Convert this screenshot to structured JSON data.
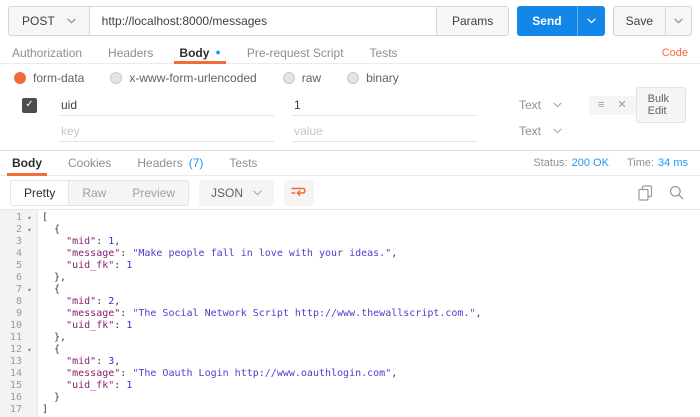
{
  "colors": {
    "accent_orange": "#f26b3a",
    "link_blue": "#2196f3",
    "send_blue": "#1287e8",
    "json_key": "#85216d",
    "json_string": "#4b41cc",
    "json_number": "#2438c8"
  },
  "icons": {
    "check": "✓",
    "reorder": "≡",
    "close": "✕",
    "fold_caret": "▾",
    "unsaved_dot": "●"
  },
  "request": {
    "method": "POST",
    "url": "http://localhost:8000/messages",
    "params_label": "Params",
    "send_label": "Send",
    "save_label": "Save",
    "code_link": "Code",
    "tabs": [
      {
        "label": "Authorization",
        "active": false
      },
      {
        "label": "Headers",
        "active": false
      },
      {
        "label": "Body",
        "active": true,
        "dot": true
      },
      {
        "label": "Pre-request Script",
        "active": false
      },
      {
        "label": "Tests",
        "active": false
      }
    ],
    "body_modes": [
      {
        "label": "form-data",
        "selected": true
      },
      {
        "label": "x-www-form-urlencoded",
        "selected": false
      },
      {
        "label": "raw",
        "selected": false
      },
      {
        "label": "binary",
        "selected": false
      }
    ],
    "form_rows": [
      {
        "key": "uid",
        "value": "1",
        "type": "Text",
        "checked": true
      }
    ],
    "new_row": {
      "key_placeholder": "key",
      "value_placeholder": "value",
      "type": "Text"
    },
    "bulk_edit_label": "Bulk Edit"
  },
  "response": {
    "tabs": [
      {
        "label": "Body",
        "active": true
      },
      {
        "label": "Cookies",
        "active": false
      },
      {
        "label": "Headers",
        "active": false,
        "count": "(7)"
      },
      {
        "label": "Tests",
        "active": false
      }
    ],
    "status_label": "Status:",
    "status_value": "200 OK",
    "time_label": "Time:",
    "time_value": "34 ms",
    "view_modes": [
      {
        "label": "Pretty",
        "active": true
      },
      {
        "label": "Raw",
        "active": false
      },
      {
        "label": "Preview",
        "active": false
      }
    ],
    "format_selector": "JSON",
    "body_json": [
      {
        "mid": 1,
        "message": "Make people fall in love with your ideas.",
        "uid_fk": 1
      },
      {
        "mid": 2,
        "message": "The Social Network Script http://www.thewallscript.com.",
        "uid_fk": 1
      },
      {
        "mid": 3,
        "message": "The Oauth Login http://www.oauthlogin.com",
        "uid_fk": 1
      }
    ],
    "code_lines": [
      {
        "n": 1,
        "fold": true,
        "seg": [
          [
            "p",
            "["
          ]
        ]
      },
      {
        "n": 2,
        "fold": true,
        "seg": [
          [
            "p",
            "  {"
          ]
        ]
      },
      {
        "n": 3,
        "seg": [
          [
            "p",
            "    "
          ],
          [
            "k",
            "\"mid\""
          ],
          [
            "p",
            ": "
          ],
          [
            "n",
            "1"
          ],
          [
            "p",
            ","
          ]
        ]
      },
      {
        "n": 4,
        "seg": [
          [
            "p",
            "    "
          ],
          [
            "k",
            "\"message\""
          ],
          [
            "p",
            ": "
          ],
          [
            "s",
            "\"Make people fall in love with your ideas.\""
          ],
          [
            "p",
            ","
          ]
        ]
      },
      {
        "n": 5,
        "seg": [
          [
            "p",
            "    "
          ],
          [
            "k",
            "\"uid_fk\""
          ],
          [
            "p",
            ": "
          ],
          [
            "n",
            "1"
          ]
        ]
      },
      {
        "n": 6,
        "seg": [
          [
            "p",
            "  },"
          ]
        ]
      },
      {
        "n": 7,
        "fold": true,
        "seg": [
          [
            "p",
            "  {"
          ]
        ]
      },
      {
        "n": 8,
        "seg": [
          [
            "p",
            "    "
          ],
          [
            "k",
            "\"mid\""
          ],
          [
            "p",
            ": "
          ],
          [
            "n",
            "2"
          ],
          [
            "p",
            ","
          ]
        ]
      },
      {
        "n": 9,
        "seg": [
          [
            "p",
            "    "
          ],
          [
            "k",
            "\"message\""
          ],
          [
            "p",
            ": "
          ],
          [
            "s",
            "\"The Social Network Script http://www.thewallscript.com.\""
          ],
          [
            "p",
            ","
          ]
        ]
      },
      {
        "n": 10,
        "seg": [
          [
            "p",
            "    "
          ],
          [
            "k",
            "\"uid_fk\""
          ],
          [
            "p",
            ": "
          ],
          [
            "n",
            "1"
          ]
        ]
      },
      {
        "n": 11,
        "seg": [
          [
            "p",
            "  },"
          ]
        ]
      },
      {
        "n": 12,
        "fold": true,
        "seg": [
          [
            "p",
            "  {"
          ]
        ]
      },
      {
        "n": 13,
        "seg": [
          [
            "p",
            "    "
          ],
          [
            "k",
            "\"mid\""
          ],
          [
            "p",
            ": "
          ],
          [
            "n",
            "3"
          ],
          [
            "p",
            ","
          ]
        ]
      },
      {
        "n": 14,
        "seg": [
          [
            "p",
            "    "
          ],
          [
            "k",
            "\"message\""
          ],
          [
            "p",
            ": "
          ],
          [
            "s",
            "\"The Oauth Login http://www.oauthlogin.com\""
          ],
          [
            "p",
            ","
          ]
        ]
      },
      {
        "n": 15,
        "seg": [
          [
            "p",
            "    "
          ],
          [
            "k",
            "\"uid_fk\""
          ],
          [
            "p",
            ": "
          ],
          [
            "n",
            "1"
          ]
        ]
      },
      {
        "n": 16,
        "seg": [
          [
            "p",
            "  }"
          ]
        ]
      },
      {
        "n": 17,
        "seg": [
          [
            "p",
            "]"
          ]
        ]
      }
    ]
  }
}
